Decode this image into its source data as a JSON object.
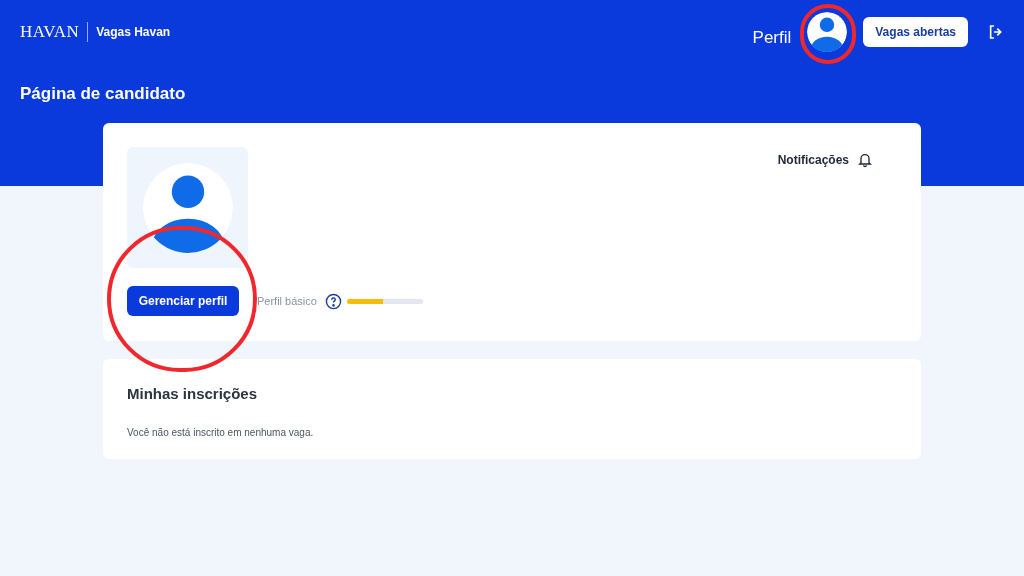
{
  "header": {
    "brand": "HAVAN",
    "site": "Vagas Havan",
    "profile_label": "Perfil",
    "avatar_circled": true,
    "open_jobs_button": "Vagas abertas"
  },
  "page_title": "Página de candidato",
  "profile_card": {
    "notifications": "Notificações",
    "manage_button": "Gerenciar perfil",
    "manage_circled": true,
    "profile_level_label": "Perfil básico",
    "level": 0.48
  },
  "applications": {
    "title": "Minhas inscrições",
    "empty_message": "Você não está inscrito em nenhuma vaga."
  }
}
